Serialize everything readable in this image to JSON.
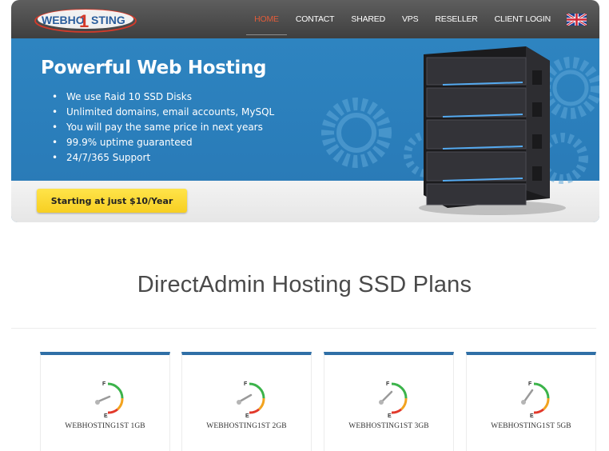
{
  "header": {
    "logo_text": "WEBHO1STING",
    "nav": [
      {
        "label": "HOME",
        "active": true
      },
      {
        "label": "CONTACT",
        "active": false
      },
      {
        "label": "SHARED",
        "active": false
      },
      {
        "label": "VPS",
        "active": false
      },
      {
        "label": "RESELLER",
        "active": false
      },
      {
        "label": "CLIENT LOGIN",
        "active": false
      }
    ],
    "language_icon": "uk-flag-icon"
  },
  "hero": {
    "title": "Powerful Web Hosting",
    "features": [
      "We use Raid 10 SSD Disks",
      "Unlimited domains, email accounts, MySQL",
      "You will pay the same price in next years",
      "99.9% uptime guaranteed",
      "24/7/365 Support"
    ],
    "cta_label": "Starting at just $10/Year",
    "art": "server-rack-icon"
  },
  "plans_section": {
    "title": "DirectAdmin Hosting SSD Plans",
    "plans": [
      {
        "name": "WEBHOSTING1ST 1GB",
        "icon": "fuel-gauge-icon"
      },
      {
        "name": "WEBHOSTING1ST 2GB",
        "icon": "fuel-gauge-icon"
      },
      {
        "name": "WEBHOSTING1ST 3GB",
        "icon": "fuel-gauge-icon"
      },
      {
        "name": "WEBHOSTING1ST 5GB",
        "icon": "fuel-gauge-icon"
      }
    ],
    "gauge_labels": {
      "full": "F",
      "empty": "E"
    }
  },
  "colors": {
    "header_bg": "#4a4a4a",
    "nav_active": "#e15c3a",
    "hero_blue": "#2b7fbc",
    "cta_yellow": "#f9d52a",
    "plan_accent": "#2f6fa6"
  }
}
